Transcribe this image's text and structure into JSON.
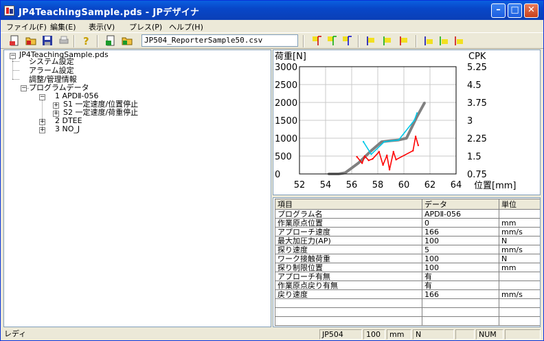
{
  "window": {
    "title": "JP4TeachingSample.pds - JPデザイナ"
  },
  "menu": [
    "ファイル(F)",
    "編集(E)",
    "表示(V)",
    "プレス(P)",
    "ヘルプ(H)"
  ],
  "toolbar": {
    "file_value": "JP504_ReporterSample50.csv"
  },
  "tree": {
    "root": "JP4TeachingSample.pds",
    "items": [
      "システム設定",
      "アラーム設定",
      "調整/管理情報",
      "プログラムデータ"
    ],
    "programs": [
      "1 APDⅡ-056",
      "2 DTEE",
      "3 NO_J"
    ],
    "steps": [
      "S1 一定速度/位置停止",
      "S2 一定速度/荷重停止"
    ]
  },
  "chart_data": {
    "type": "line",
    "xlabel": "位置[mm]",
    "ylabel": "荷重[N]",
    "y2label": "CPK",
    "xlim": [
      52,
      64
    ],
    "ylim": [
      0,
      3000
    ],
    "y2lim": [
      0.75,
      5.25
    ],
    "x_ticks": [
      52,
      54,
      56,
      58,
      60,
      62,
      64
    ],
    "y_ticks": [
      0,
      500,
      1000,
      1500,
      2000,
      2500,
      3000
    ],
    "y2_ticks": [
      "0.75",
      "1.5",
      "2.25",
      "3",
      "3.75",
      "4.5",
      "5.25"
    ],
    "series": [
      {
        "color": "#808080",
        "x": [
          54.2,
          55.0,
          55.5,
          56.5,
          57.5,
          58.3,
          59.0,
          59.6,
          60.2,
          61.0,
          61.6
        ],
        "y": [
          0,
          0,
          30,
          300,
          650,
          900,
          930,
          950,
          1000,
          1600,
          2000
        ]
      },
      {
        "color": "#ff0000",
        "x": [
          56.4,
          56.8,
          57.0,
          57.3,
          57.6,
          58.1,
          58.4,
          58.7,
          58.9,
          59.2,
          59.4,
          60.7,
          60.9,
          61.1
        ],
        "y": [
          480,
          300,
          500,
          380,
          420,
          620,
          250,
          520,
          120,
          620,
          400,
          650,
          1050,
          800
        ]
      },
      {
        "color": "#00c8e8",
        "x": [
          56.9,
          57.5,
          58.5,
          59.6,
          60.8,
          61.0
        ],
        "y": [
          900,
          550,
          900,
          950,
          1500,
          1700
        ]
      }
    ]
  },
  "grid": {
    "headers": [
      "項目",
      "データ",
      "単位"
    ],
    "rows": [
      [
        "プログラム名",
        "APDⅡ-056",
        ""
      ],
      [
        "作業原点位置",
        "0",
        "mm"
      ],
      [
        "アプローチ速度",
        "166",
        "mm/s"
      ],
      [
        "最大加圧力(AP)",
        "100",
        "N"
      ],
      [
        "探り速度",
        "5",
        "mm/s"
      ],
      [
        "ワーク接触荷重",
        "100",
        "N"
      ],
      [
        "探り制限位置",
        "100",
        "mm"
      ],
      [
        "アプローチ有無",
        "有",
        ""
      ],
      [
        "作業原点戻り有無",
        "有",
        ""
      ],
      [
        "戻り速度",
        "166",
        "mm/s"
      ],
      [
        "",
        "",
        ""
      ],
      [
        "",
        "",
        ""
      ],
      [
        "",
        "",
        ""
      ]
    ]
  },
  "status": {
    "ready": "レディ",
    "model": "JP504",
    "value": "100",
    "unit": "mm",
    "mode": "N",
    "num": "NUM"
  },
  "colors": {
    "title_bar": "#0a4fd4",
    "accent": "#0831d9"
  }
}
